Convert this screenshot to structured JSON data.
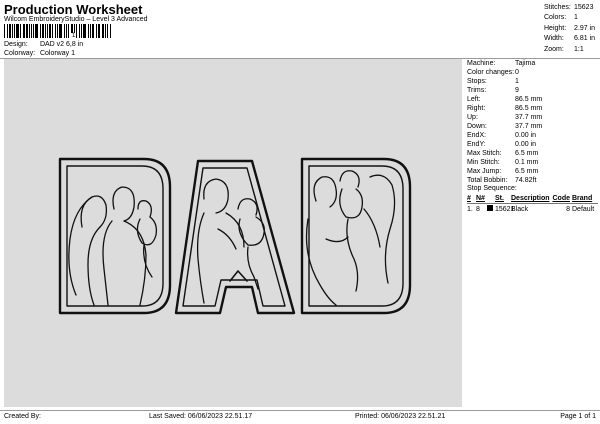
{
  "header": {
    "title": "Production Worksheet",
    "subtitle": "Wilcom EmbroideryStudio – Level 3 Advanced",
    "barcode_number": "1",
    "design_label": "Design:",
    "design_value": "DAD v2 6,8 in",
    "colorway_label": "Colorway:",
    "colorway_value": "Colorway 1"
  },
  "top_stats": [
    {
      "label": "Stitches:",
      "value": "15623"
    },
    {
      "label": "Colors:",
      "value": "1"
    },
    {
      "label": "Height:",
      "value": "2.97 in"
    },
    {
      "label": "Width:",
      "value": "6.81 in"
    },
    {
      "label": "Zoom:",
      "value": "1:1"
    }
  ],
  "properties": [
    {
      "label": "Machine:",
      "value": "Tajima"
    },
    {
      "label": "Color changes:",
      "value": "0"
    },
    {
      "label": "Stops:",
      "value": "1"
    },
    {
      "label": "Trims:",
      "value": "9"
    },
    {
      "label": "Left:",
      "value": "86.5 mm"
    },
    {
      "label": "Right:",
      "value": "86.5 mm"
    },
    {
      "label": "Up:",
      "value": "37.7 mm"
    },
    {
      "label": "Down:",
      "value": "37.7 mm"
    },
    {
      "label": "EndX:",
      "value": "0.00 in"
    },
    {
      "label": "EndY:",
      "value": "0.00 in"
    },
    {
      "label": "Max Stitch:",
      "value": "6.5 mm"
    },
    {
      "label": "Min Stitch:",
      "value": "0.1 mm"
    },
    {
      "label": "Max Jump:",
      "value": "6.5 mm"
    },
    {
      "label": "Total Bobbin:",
      "value": "74.82ft"
    }
  ],
  "stop_sequence": {
    "title": "Stop Sequence:",
    "headers": {
      "num": "#",
      "n": "N#",
      "st": "St.",
      "description": "Description",
      "code": "Code",
      "brand": "Brand"
    },
    "rows": [
      {
        "num": "1.",
        "n": "8",
        "swatch_color": "#000000",
        "st": "15621",
        "description": "Black",
        "code": "8",
        "brand": "Default"
      }
    ]
  },
  "design_preview": {
    "background": "#dcdcdc",
    "thread_color": "#111111"
  },
  "footer": {
    "created_by": "Created By:",
    "last_saved": "Last Saved: 06/06/2023 22.51.17",
    "printed": "Printed: 06/06/2023 22.51.21",
    "page": "Page 1 of 1"
  }
}
